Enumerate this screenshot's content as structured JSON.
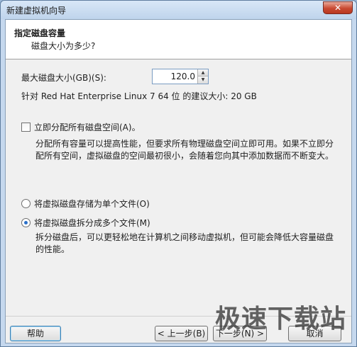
{
  "window": {
    "title": "新建虚拟机向导",
    "close_label": "✕"
  },
  "header": {
    "title": "指定磁盘容量",
    "subtitle": "磁盘大小为多少?"
  },
  "disk_size": {
    "label": "最大磁盘大小(GB)(S):",
    "value": "120.0",
    "up_arrow": "▲",
    "down_arrow": "▼"
  },
  "recommendation": "针对 Red Hat Enterprise Linux 7 64 位 的建议大小: 20 GB",
  "allocate": {
    "label": "立即分配所有磁盘空间(A)。",
    "checked": false,
    "description": "分配所有容量可以提高性能，但要求所有物理磁盘空间立即可用。如果不立即分配所有空间，虚拟磁盘的空间最初很小，会随着您向其中添加数据而不断变大。"
  },
  "storage_options": [
    {
      "label": "将虚拟磁盘存储为单个文件(O)",
      "selected": false
    },
    {
      "label": "将虚拟磁盘拆分成多个文件(M)",
      "selected": true
    }
  ],
  "split_description": "拆分磁盘后，可以更轻松地在计算机之间移动虚拟机，但可能会降低大容量磁盘的性能。",
  "buttons": {
    "help": "帮助",
    "back": "< 上一步(B)",
    "next": "下一步(N) >",
    "cancel": "取消"
  },
  "watermark": "极速下载站"
}
